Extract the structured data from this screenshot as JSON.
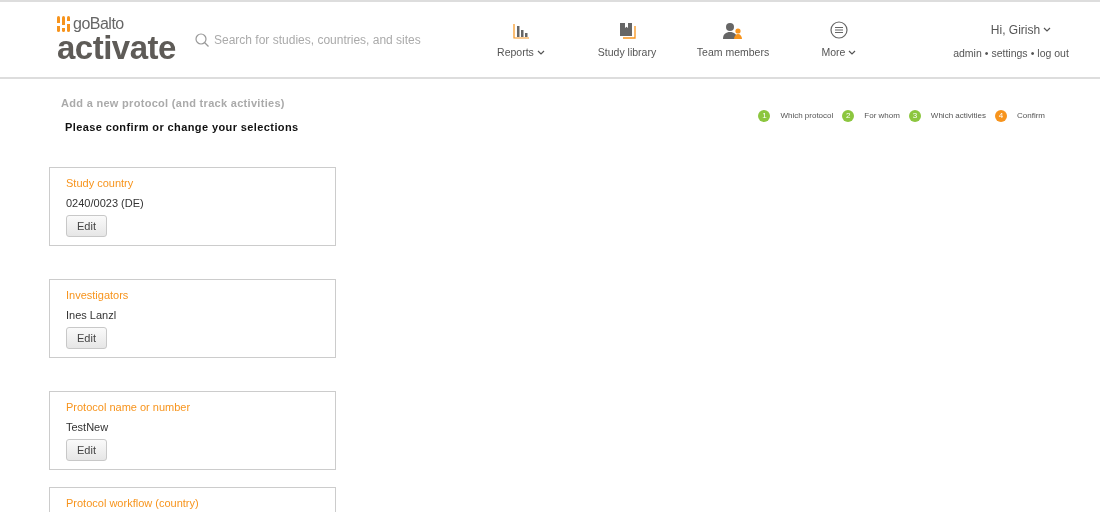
{
  "header": {
    "logo": {
      "brand": "goBalto",
      "product": "activate"
    },
    "search": {
      "placeholder": "Search for studies, countries, and sites"
    },
    "nav": [
      {
        "label": "Reports",
        "dropdown": true
      },
      {
        "label": "Study library",
        "dropdown": false
      },
      {
        "label": "Team members",
        "dropdown": false
      },
      {
        "label": "More",
        "dropdown": true
      }
    ],
    "user": {
      "greeting": "Hi, Girish",
      "links": [
        "admin",
        "settings",
        "log out"
      ],
      "separator": "•"
    }
  },
  "page": {
    "title": "Add a new protocol (and track activities)",
    "subtitle": "Please confirm or change your selections",
    "steps": [
      {
        "number": "1",
        "label": "Which protocol",
        "color": "#8cc63f"
      },
      {
        "number": "2",
        "label": "For whom",
        "color": "#8cc63f"
      },
      {
        "number": "3",
        "label": "Which activities",
        "color": "#8cc63f"
      },
      {
        "number": "4",
        "label": "Confirm",
        "color": "#f7941d"
      }
    ],
    "cards": [
      {
        "title": "Study country",
        "value": "0240/0023 (DE)",
        "button": "Edit"
      },
      {
        "title": "Investigators",
        "value": "Ines Lanzl",
        "button": "Edit"
      },
      {
        "title": "Protocol name or number",
        "value": "TestNew",
        "button": "Edit"
      },
      {
        "title": "Protocol workflow (country)"
      }
    ]
  }
}
